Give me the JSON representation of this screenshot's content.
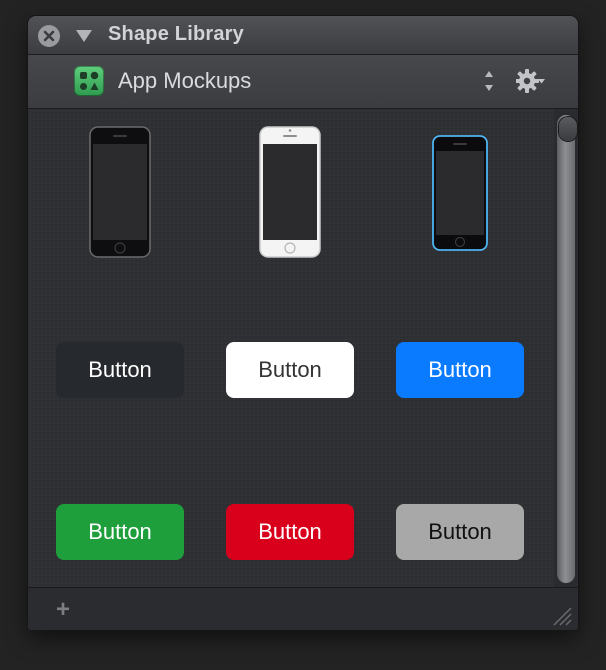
{
  "window": {
    "title": "Shape Library"
  },
  "library": {
    "name": "App Mockups"
  },
  "shapes": {
    "phones": [
      {
        "name": "iphone-black",
        "body": "#0e0e10",
        "bezel": "#6a6b6e",
        "screen": "#2b2b2d",
        "detail": "#3a3a3c"
      },
      {
        "name": "iphone-white",
        "body": "#f4f4f4",
        "bezel": "#c9c9c9",
        "screen": "#2b2b2d",
        "detail": "#8e8e8e"
      },
      {
        "name": "iphone-blue",
        "body": "#0b0b0d",
        "bezel": "#4eb3f0",
        "screen": "#2b2b2d",
        "detail": "#3a3a3c"
      }
    ],
    "buttons": [
      {
        "label": "Button",
        "bg": "#26292e",
        "fg": "#ffffff"
      },
      {
        "label": "Button",
        "bg": "#ffffff",
        "fg": "#333333"
      },
      {
        "label": "Button",
        "bg": "#0a7bff",
        "fg": "#ffffff"
      },
      {
        "label": "Button",
        "bg": "#1f9e3c",
        "fg": "#ffffff"
      },
      {
        "label": "Button",
        "bg": "#d9001b",
        "fg": "#ffffff"
      },
      {
        "label": "Button",
        "bg": "#a8a8a8",
        "fg": "#111111"
      }
    ]
  },
  "footer": {
    "add_label": "+"
  },
  "icons": {
    "close": "close-icon",
    "disclosure": "triangle-down-icon",
    "library": "shapes-icon",
    "stepper": "up-down-arrows-icon",
    "gear": "gear-icon",
    "grip": "resize-grip-icon"
  }
}
